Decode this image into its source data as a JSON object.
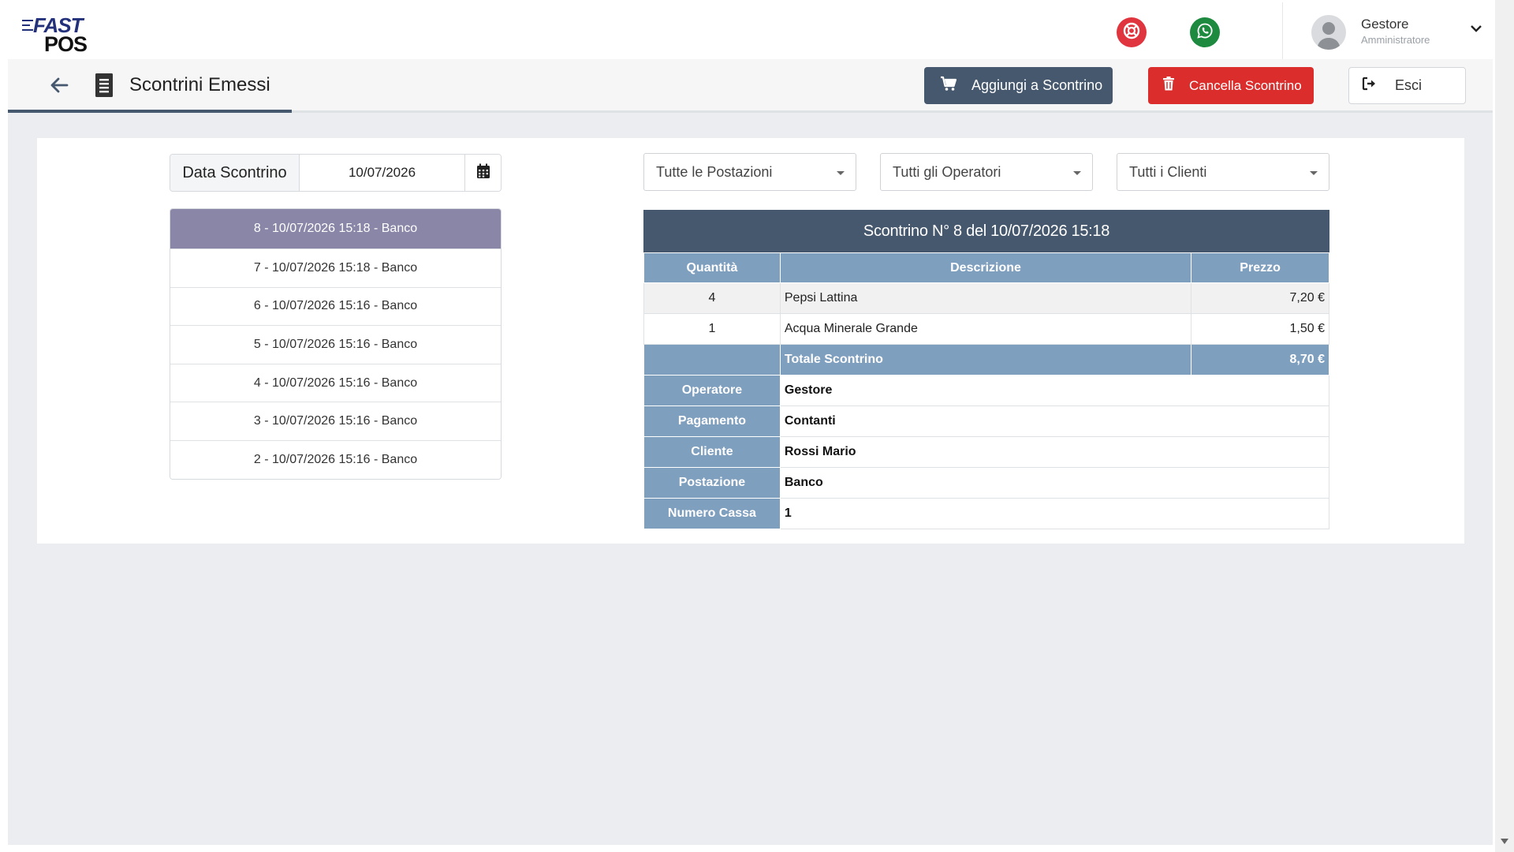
{
  "header": {
    "logo_top": "FAST",
    "logo_bottom": "POS",
    "user": {
      "name": "Gestore",
      "role": "Amministratore"
    }
  },
  "toolbar": {
    "title": "Scontrini Emessi",
    "add_label": "Aggiungi a Scontrino",
    "delete_label": "Cancella Scontrino",
    "exit_label": "Esci"
  },
  "date_filter": {
    "label": "Data Scontrino",
    "value": "10/07/2026"
  },
  "receipts": [
    {
      "label": "8 - 10/07/2026 15:18 - Banco",
      "selected": true
    },
    {
      "label": "7 - 10/07/2026 15:18 - Banco"
    },
    {
      "label": "6 - 10/07/2026 15:16 - Banco"
    },
    {
      "label": "5 - 10/07/2026 15:16 - Banco"
    },
    {
      "label": "4 - 10/07/2026 15:16 - Banco"
    },
    {
      "label": "3 - 10/07/2026 15:16 - Banco"
    },
    {
      "label": "2 - 10/07/2026 15:16 - Banco"
    }
  ],
  "filters": {
    "postazioni": "Tutte le Postazioni",
    "operatori": "Tutti gli Operatori",
    "clienti": "Tutti i Clienti"
  },
  "detail": {
    "title": "Scontrino N° 8 del 10/07/2026 15:18",
    "columns": {
      "qty": "Quantità",
      "desc": "Descrizione",
      "price": "Prezzo"
    },
    "items": [
      {
        "qty": "4",
        "desc": "Pepsi Lattina",
        "price": "7,20 €"
      },
      {
        "qty": "1",
        "desc": "Acqua Minerale Grande",
        "price": "1,50 €"
      }
    ],
    "total": {
      "label": "Totale Scontrino",
      "value": "8,70 €"
    },
    "info": [
      {
        "label": "Operatore",
        "value": "Gestore"
      },
      {
        "label": "Pagamento",
        "value": "Contanti"
      },
      {
        "label": "Cliente",
        "value": "Rossi Mario"
      },
      {
        "label": "Postazione",
        "value": "Banco"
      },
      {
        "label": "Numero Cassa",
        "value": "1"
      }
    ]
  },
  "colors": {
    "primary": "#46586d",
    "danger": "#dc2d2d",
    "table_header": "#7f9fbf",
    "selected_receipt": "#8a86a7",
    "whatsapp": "#1e8a40",
    "help": "#e0353f"
  },
  "icons": {
    "help": "lifebuoy-icon",
    "whatsapp": "whatsapp-icon",
    "back": "arrow-left-icon",
    "receipt": "receipt-icon",
    "cart": "cart-icon",
    "trash": "trash-icon",
    "exit": "sign-out-icon",
    "calendar": "calendar-icon",
    "dropdown": "chevron-down-icon"
  }
}
